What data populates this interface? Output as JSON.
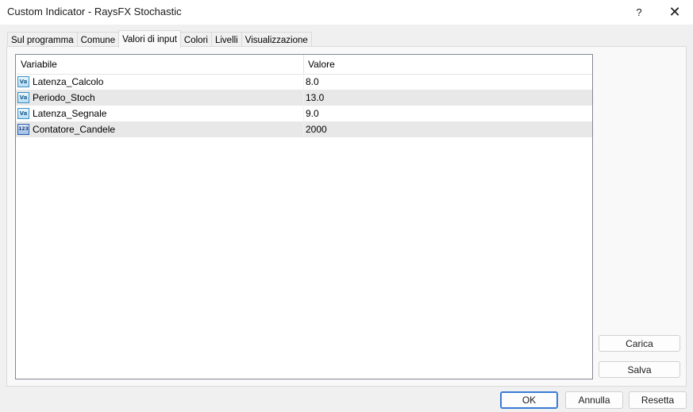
{
  "window": {
    "title": "Custom Indicator - RaysFX Stochastic",
    "help_label": "?",
    "close_label": "✕"
  },
  "tabs": [
    {
      "label": "Sul programma",
      "active": false
    },
    {
      "label": "Comune",
      "active": false
    },
    {
      "label": "Valori di input",
      "active": true
    },
    {
      "label": "Colori",
      "active": false
    },
    {
      "label": "Livelli",
      "active": false
    },
    {
      "label": "Visualizzazione",
      "active": false
    }
  ],
  "inputs_table": {
    "columns": {
      "variable": "Variabile",
      "value": "Valore"
    },
    "rows": [
      {
        "icon": "double-value-icon",
        "icon_text": "Va",
        "name": "Latenza_Calcolo",
        "value": "8.0"
      },
      {
        "icon": "double-value-icon",
        "icon_text": "Va",
        "name": "Periodo_Stoch",
        "value": "13.0"
      },
      {
        "icon": "double-value-icon",
        "icon_text": "Va",
        "name": "Latenza_Segnale",
        "value": "9.0"
      },
      {
        "icon": "integer-value-icon",
        "icon_text": "123",
        "name": "Contatore_Candele",
        "value": "2000"
      }
    ]
  },
  "side_buttons": {
    "load_label": "Carica",
    "save_label": "Salva"
  },
  "footer_buttons": {
    "ok_label": "OK",
    "cancel_label": "Annulla",
    "reset_label": "Resetta"
  },
  "colors": {
    "accent": "#3a7bd5",
    "row_highlight": "#e8e8e8"
  }
}
